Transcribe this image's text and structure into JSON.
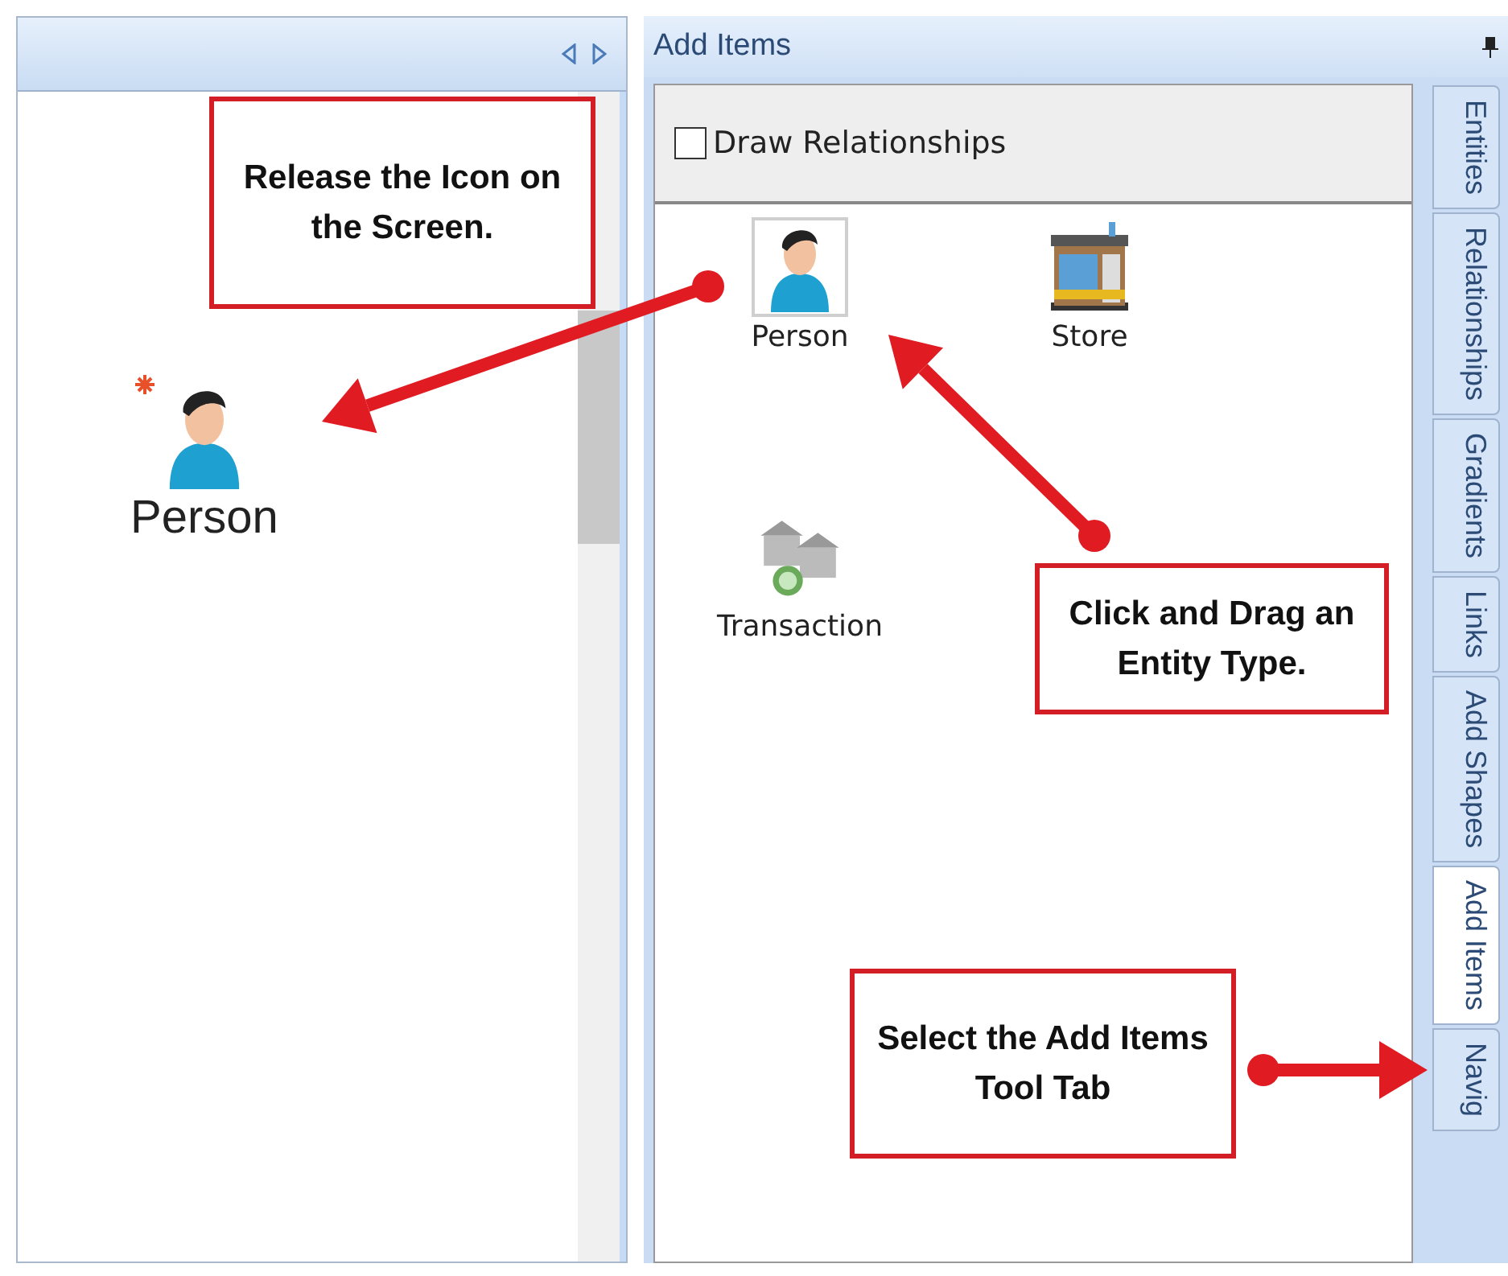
{
  "canvas_pane": {
    "placed_entity": {
      "label": "Person",
      "is_new": true
    }
  },
  "tool_panel": {
    "title": "Add Items",
    "draw_relationships": {
      "label": "Draw Relationships",
      "checked": false
    },
    "entity_types": [
      {
        "label": "Person",
        "kind": "person",
        "selected": true
      },
      {
        "label": "Store",
        "kind": "store",
        "selected": false
      },
      {
        "label": "Transaction",
        "kind": "transaction",
        "selected": false
      }
    ]
  },
  "tabs": [
    {
      "label": "Entities",
      "selected": false
    },
    {
      "label": "Relationships",
      "selected": false
    },
    {
      "label": "Gradients",
      "selected": false
    },
    {
      "label": "Links",
      "selected": false
    },
    {
      "label": "Add Shapes",
      "selected": false
    },
    {
      "label": "Add Items",
      "selected": true
    },
    {
      "label": "Navig",
      "selected": false
    }
  ],
  "callouts": [
    {
      "text": "Release the Icon on the Screen."
    },
    {
      "text": "Click and Drag an Entity Type."
    },
    {
      "text": "Select the Add Items Tool Tab"
    }
  ]
}
